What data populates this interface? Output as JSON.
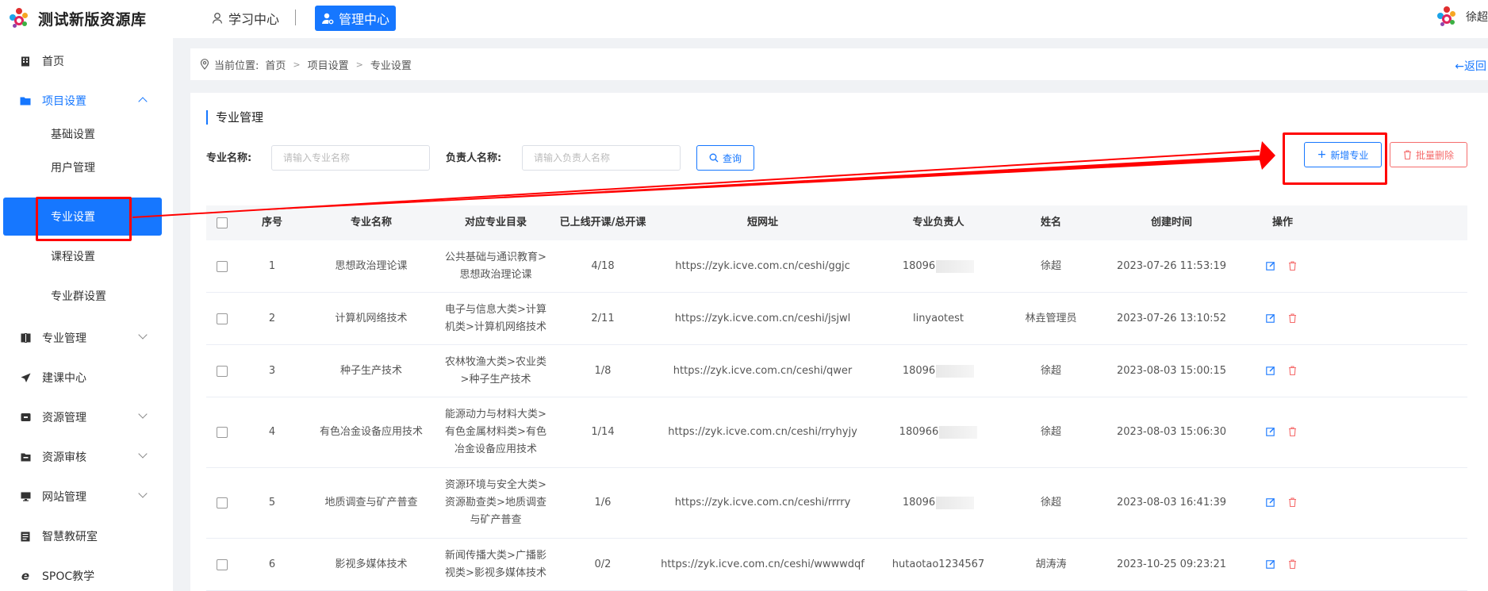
{
  "header": {
    "app_title": "测试新版资源库",
    "nav": {
      "learning_center": "学习中心",
      "management_center": "管理中心"
    },
    "user_name": "徐超"
  },
  "sidebar": {
    "items": [
      {
        "label": "首页",
        "icon": "building-icon"
      },
      {
        "label": "项目设置",
        "icon": "folder-icon",
        "expanded": true
      },
      {
        "label": "基础设置"
      },
      {
        "label": "用户管理"
      },
      {
        "label": "专业设置",
        "selected": true
      },
      {
        "label": "课程设置"
      },
      {
        "label": "专业群设置"
      },
      {
        "label": "专业管理",
        "icon": "book-icon"
      },
      {
        "label": "建课中心",
        "icon": "send-icon"
      },
      {
        "label": "资源管理",
        "icon": "box-icon"
      },
      {
        "label": "资源审核",
        "icon": "folder-check-icon"
      },
      {
        "label": "网站管理",
        "icon": "monitor-icon"
      },
      {
        "label": "智慧教研室",
        "icon": "document-icon"
      },
      {
        "label": "SPOC教学",
        "icon": "e-icon"
      }
    ]
  },
  "breadcrumb": {
    "prefix": "当前位置:",
    "items": [
      "首页",
      "项目设置",
      "专业设置"
    ],
    "back": "←返回"
  },
  "page": {
    "section_title": "专业管理",
    "filters": {
      "name_label": "专业名称:",
      "name_placeholder": "请输入专业名称",
      "owner_label": "负责人名称:",
      "owner_placeholder": "请输入负责人名称",
      "query_button": "查询"
    },
    "actions": {
      "add": "新增专业",
      "batch_delete": "批量删除"
    }
  },
  "table": {
    "columns": [
      "序号",
      "专业名称",
      "对应专业目录",
      "已上线开课/总开课",
      "短网址",
      "专业负责人",
      "姓名",
      "创建时间",
      "操作"
    ],
    "rows": [
      {
        "no": "1",
        "name": "思想政治理论课",
        "catalog": "公共基础与通识教育>思想政治理论课",
        "courses": "4/18",
        "url": "https://zyk.icve.com.cn/ceshi/ggjc",
        "owner": "18096",
        "owner_masked": true,
        "real_name": "徐超",
        "created": "2023-07-26 11:53:19"
      },
      {
        "no": "2",
        "name": "计算机网络技术",
        "catalog": "电子与信息大类>计算机类>计算机网络技术",
        "courses": "2/11",
        "url": "https://zyk.icve.com.cn/ceshi/jsjwl",
        "owner": "linyaotest",
        "owner_masked": false,
        "real_name": "林垚管理员",
        "created": "2023-07-26 13:10:52"
      },
      {
        "no": "3",
        "name": "种子生产技术",
        "catalog": "农林牧渔大类>农业类>种子生产技术",
        "courses": "1/8",
        "url": "https://zyk.icve.com.cn/ceshi/qwer",
        "owner": "18096",
        "owner_masked": true,
        "real_name": "徐超",
        "created": "2023-08-03 15:00:15"
      },
      {
        "no": "4",
        "name": "有色冶金设备应用技术",
        "catalog": "能源动力与材料大类>有色金属材料类>有色冶金设备应用技术",
        "courses": "1/14",
        "url": "https://zyk.icve.com.cn/ceshi/rryhyjy",
        "owner": "180966",
        "owner_masked": true,
        "real_name": "徐超",
        "created": "2023-08-03 15:06:30"
      },
      {
        "no": "5",
        "name": "地质调查与矿产普查",
        "catalog": "资源环境与安全大类>资源勘查类>地质调查与矿产普查",
        "courses": "1/6",
        "url": "https://zyk.icve.com.cn/ceshi/rrrry",
        "owner": "18096",
        "owner_masked": true,
        "real_name": "徐超",
        "created": "2023-08-03 16:41:39"
      },
      {
        "no": "6",
        "name": "影视多媒体技术",
        "catalog": "新闻传播大类>广播影视类>影视多媒体技术",
        "courses": "0/2",
        "url": "https://zyk.icve.com.cn/ceshi/wwwwdqf",
        "owner": "hutaotao1234567",
        "owner_masked": false,
        "real_name": "胡涛涛",
        "created": "2023-10-25 09:23:21"
      }
    ]
  },
  "colors": {
    "primary": "#1677ff",
    "danger": "#f56c6c",
    "annotation": "#ff0000"
  }
}
